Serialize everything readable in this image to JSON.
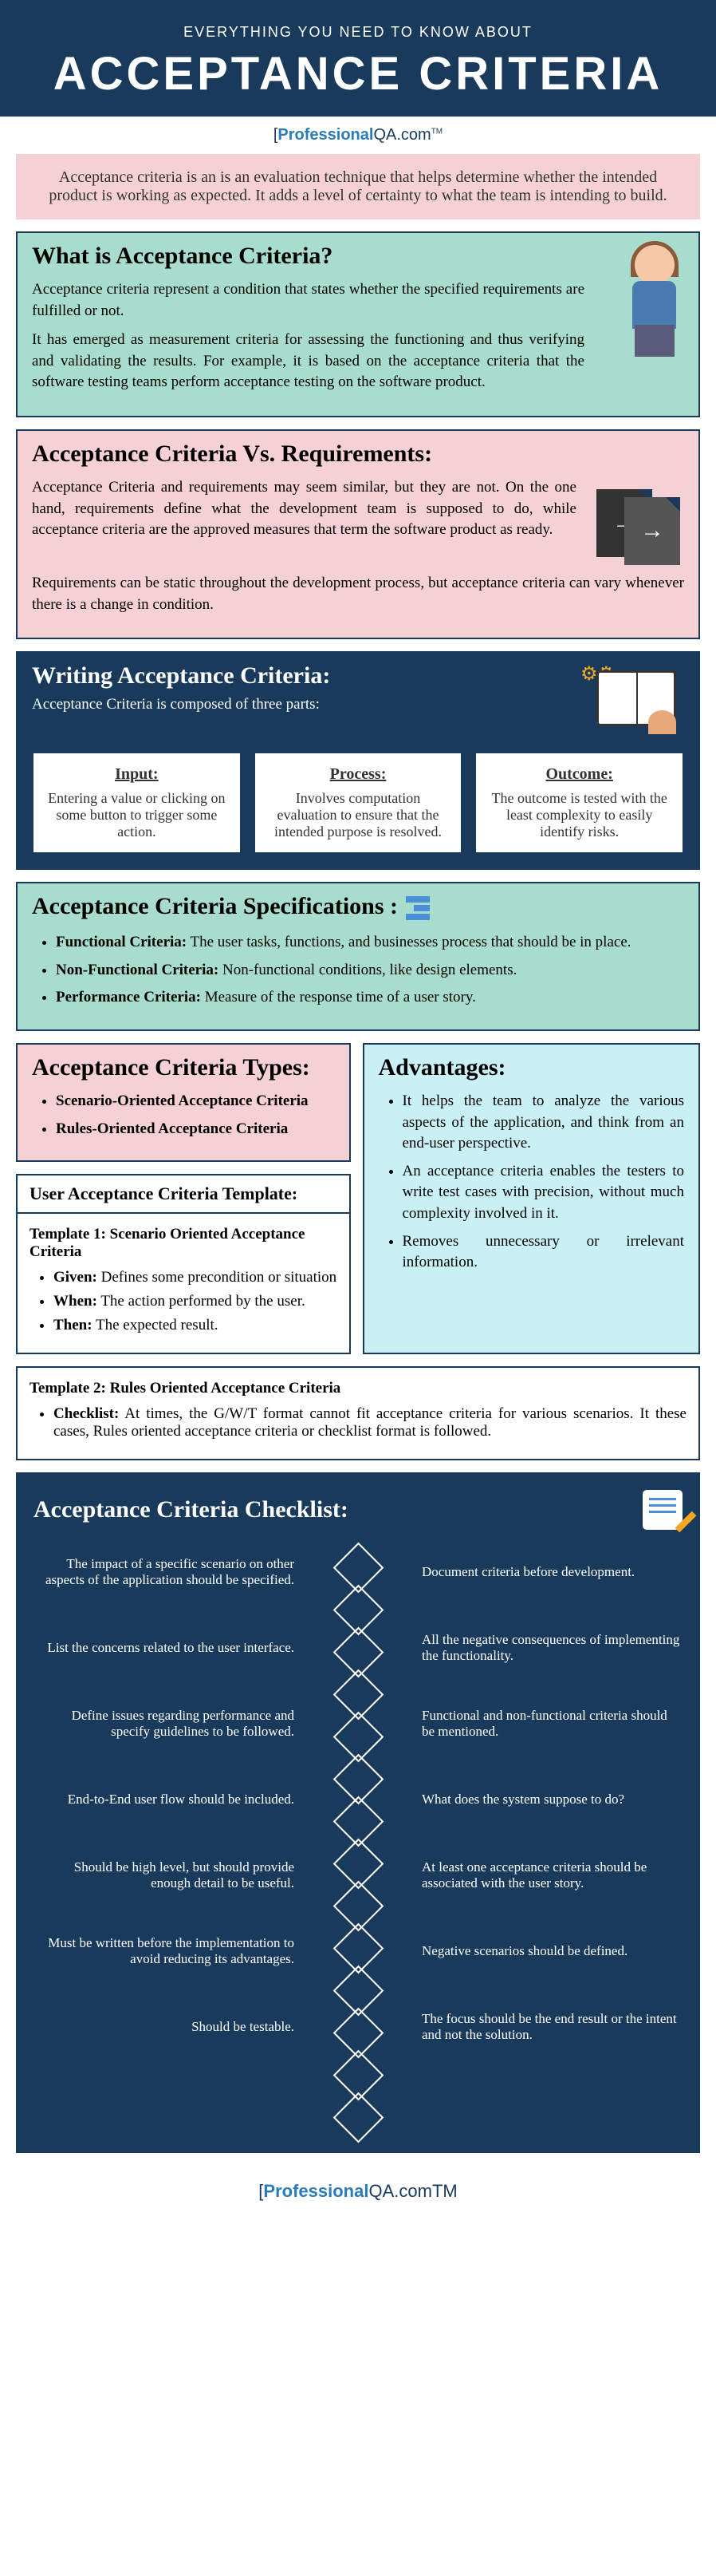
{
  "header": {
    "sub": "EVERYTHING YOU NEED TO KNOW ABOUT",
    "title": "ACCEPTANCE CRITERIA"
  },
  "logo": {
    "p1": "Professional",
    "p2": "QA.com",
    "tm": "TM"
  },
  "intro": "Acceptance criteria is an  is an evaluation technique that helps determine whether the intended product is working as expected. It adds a level of certainty to what the team is intending to build.",
  "what": {
    "title": "What is Acceptance Criteria?",
    "p1": "Acceptance criteria represent a condition that states whether the specified requirements are fulfilled or not.",
    "p2": "It has emerged as measurement criteria for assessing the functioning and thus verifying and validating the results. For example, it is based on the acceptance criteria that the software testing teams perform acceptance testing on the software product."
  },
  "vs": {
    "title": "Acceptance Criteria Vs. Requirements:",
    "p1": "Acceptance Criteria and requirements may seem similar, but they are not. On the one hand, requirements define what the development team is supposed to do, while acceptance criteria are the approved measures that term the software product as ready.",
    "p2": "Requirements can be static throughout the development process, but acceptance criteria can vary whenever there is a change in condition."
  },
  "writing": {
    "title": "Writing Acceptance Criteria:",
    "sub": "Acceptance Criteria is composed of three parts:",
    "parts": [
      {
        "h": "Input:",
        "t": "Entering a value or clicking on some button to trigger some action."
      },
      {
        "h": "Process:",
        "t": "Involves computation evaluation to ensure that the intended purpose is resolved."
      },
      {
        "h": "Outcome:",
        "t": "The outcome is tested with the least complexity to easily identify risks."
      }
    ]
  },
  "specs": {
    "title": "Acceptance Criteria Specifications :",
    "items": [
      {
        "b": "Functional Criteria:",
        "t": " The user tasks, functions, and businesses process that should be in place."
      },
      {
        "b": "Non-Functional Criteria:",
        "t": " Non-functional conditions, like design elements."
      },
      {
        "b": "Performance Criteria:",
        "t": " Measure of the response time of a user story."
      }
    ]
  },
  "types": {
    "title": "Acceptance Criteria Types:",
    "items": [
      "Scenario-Oriented Acceptance Criteria",
      "Rules-Oriented Acceptance Criteria"
    ]
  },
  "advantages": {
    "title": "Advantages:",
    "items": [
      "It helps the team to analyze the various aspects of the application, and think from an end-user perspective.",
      "An acceptance criteria enables the testers to write test cases with precision, without much complexity involved in it.",
      "Removes unnecessary or irrelevant information."
    ]
  },
  "template": {
    "title": "User Acceptance Criteria Template:",
    "t1": {
      "h": "Template 1: Scenario Oriented Acceptance Criteria",
      "items": [
        {
          "b": "Given:",
          "t": " Defines some precondition or situation"
        },
        {
          "b": "When:",
          "t": " The action performed by the user."
        },
        {
          "b": "Then:",
          "t": " The expected result."
        }
      ]
    },
    "t2": {
      "h": "Template 2: Rules Oriented Acceptance Criteria",
      "b": "Checklist:",
      "t": " At times, the G/W/T format cannot fit acceptance criteria for various scenarios. It these cases, Rules oriented acceptance criteria or checklist format is followed."
    }
  },
  "checklist": {
    "title": "Acceptance Criteria Checklist:",
    "left": [
      "The impact of a specific scenario on other aspects of the application should be specified.",
      "List the concerns related to the user interface.",
      "Define issues regarding performance and specify guidelines to be followed.",
      "End-to-End user flow should be included.",
      "Should be high level, but should provide enough detail to be useful.",
      "Must be written before the implementation to avoid reducing its advantages.",
      "Should be testable."
    ],
    "right": [
      "Document criteria before development.",
      "All the negative consequences of implementing the functionality.",
      "Functional and non-functional criteria should be mentioned.",
      "What does the system suppose to do?",
      "At least one acceptance criteria should be associated with the user story.",
      "Negative scenarios should be defined.",
      "The focus should be the end result or the intent and not the solution."
    ]
  }
}
